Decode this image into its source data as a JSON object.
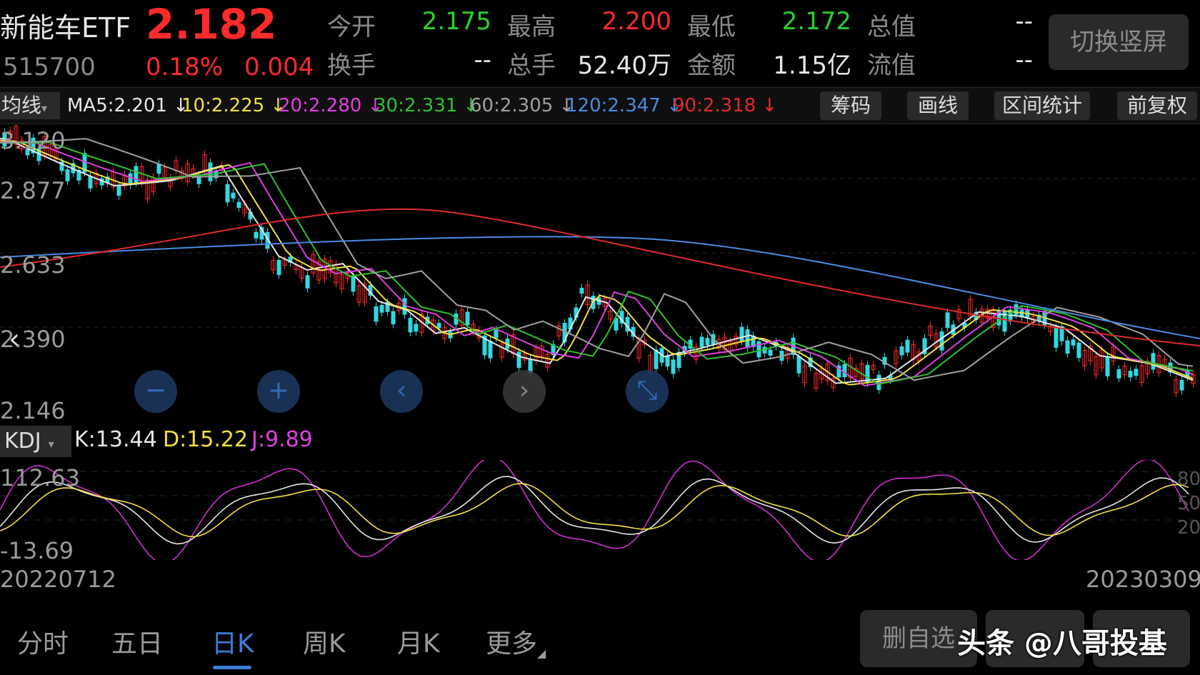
{
  "header": {
    "name": "新能车ETF",
    "price": "2.182",
    "code": "515700",
    "pct_change": "0.18%",
    "change": "0.004",
    "quote_rows": [
      [
        {
          "label": "今开",
          "value": "2.175",
          "color": "#2bd02b"
        },
        {
          "label": "最高",
          "value": "2.200",
          "color": "#ff2a2a"
        },
        {
          "label": "最低",
          "value": "2.172",
          "color": "#2bd02b"
        },
        {
          "label": "总值",
          "value": "--",
          "color": "#e6e6e6"
        }
      ],
      [
        {
          "label": "换手",
          "value": "--",
          "color": "#e6e6e6"
        },
        {
          "label": "总手",
          "value": "52.40万",
          "color": "#e6e6e6"
        },
        {
          "label": "金额",
          "value": "1.15亿",
          "color": "#e6e6e6"
        },
        {
          "label": "流值",
          "value": "--",
          "color": "#e6e6e6"
        }
      ]
    ],
    "switch_button": "切换竖屏"
  },
  "ma_bar": {
    "selector": "均线",
    "items": [
      {
        "text": "MA5:2.201 ↓",
        "color": "#e6e6e6"
      },
      {
        "text": "10:2.225 ↓",
        "color": "#f0e040"
      },
      {
        "text": "20:2.280 ↓",
        "color": "#e040e0"
      },
      {
        "text": "30:2.331 ↓",
        "color": "#30c030"
      },
      {
        "text": "60:2.305 ↓",
        "color": "#a0a0a0"
      },
      {
        "text": "120:2.347 ↓",
        "color": "#4a8ae0"
      },
      {
        "text": "90:2.318 ↓",
        "color": "#e02a2a"
      }
    ],
    "tools": [
      "筹码",
      "画线",
      "区间统计",
      "前复权"
    ]
  },
  "price_axis": [
    "3.120",
    "2.877",
    "2.633",
    "2.390",
    "2.146"
  ],
  "chart_controls": [
    "−",
    "+",
    "‹",
    "›",
    "⤡"
  ],
  "kdj": {
    "selector": "KDJ",
    "k": "K:13.44",
    "d": "D:15.22",
    "j": "J:9.89",
    "axis_left": [
      "112.63",
      "-13.69"
    ],
    "axis_right": [
      "80",
      "50",
      "20"
    ]
  },
  "dates": {
    "start": "20220712",
    "end": "20230309"
  },
  "tabs": [
    "分时",
    "五日",
    "日K",
    "周K",
    "月K",
    "更多"
  ],
  "active_tab": 2,
  "bottom_buttons": [
    "删自选",
    "",
    ""
  ],
  "watermark": "头条 @八哥投基",
  "colors": {
    "up": "#ff2a2a",
    "down": "#30d8e0",
    "accent": "#3c7dd9"
  }
}
